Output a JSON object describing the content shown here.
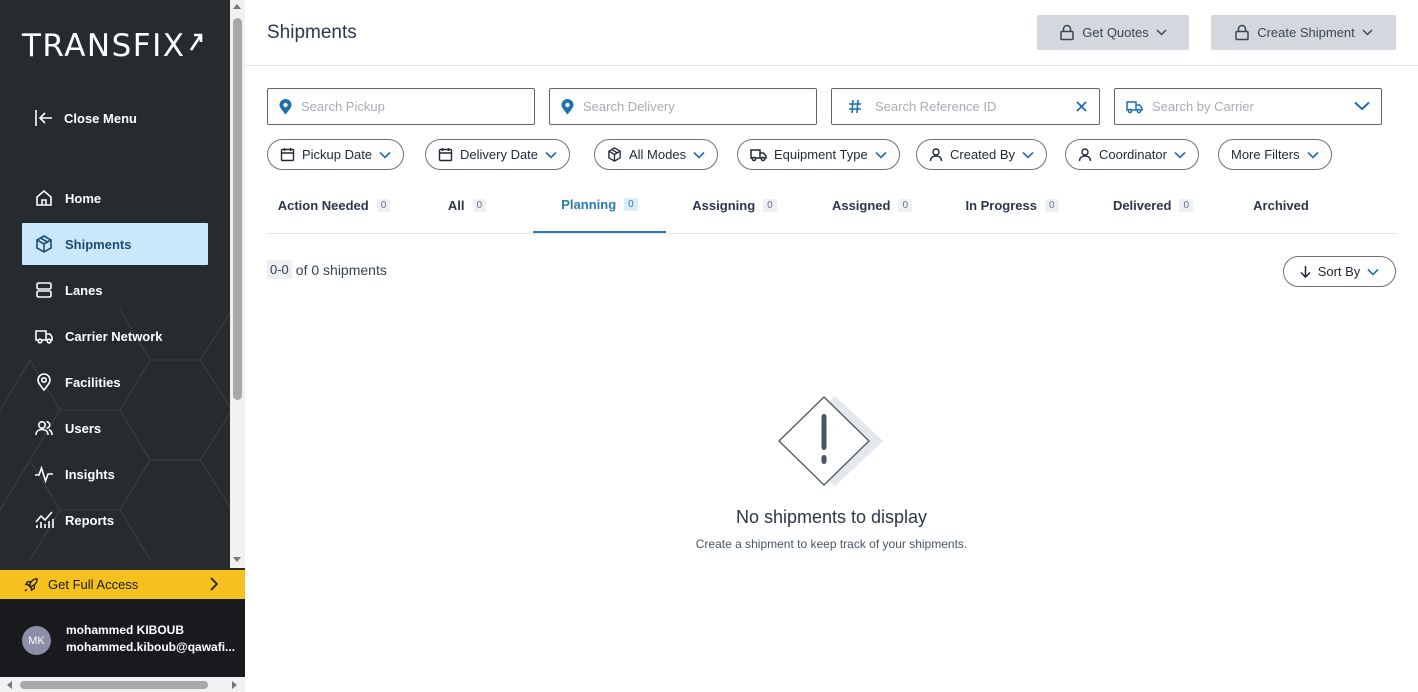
{
  "app": {
    "logo_text": "TRANSFIX"
  },
  "sidebar": {
    "close_menu_label": "Close Menu",
    "items": [
      {
        "label": "Home",
        "icon": "home-icon"
      },
      {
        "label": "Shipments",
        "icon": "box-icon",
        "active": true
      },
      {
        "label": "Lanes",
        "icon": "lanes-icon"
      },
      {
        "label": "Carrier Network",
        "icon": "truck-icon"
      },
      {
        "label": "Facilities",
        "icon": "location-pin-icon"
      },
      {
        "label": "Users",
        "icon": "users-icon"
      },
      {
        "label": "Insights",
        "icon": "pulse-icon"
      },
      {
        "label": "Reports",
        "icon": "chart-icon"
      }
    ],
    "access_label": "Get Full Access",
    "user": {
      "initials": "MK",
      "name": "mohammed KIBOUB",
      "email": "mohammed.kiboub@qawafi..."
    }
  },
  "header": {
    "title": "Shipments",
    "get_quotes_label": "Get Quotes",
    "create_shipment_label": "Create Shipment"
  },
  "search": {
    "pickup_placeholder": "Search Pickup",
    "delivery_placeholder": "Search Delivery",
    "reference_placeholder": "Search Reference ID",
    "carrier_placeholder": "Search by Carrier"
  },
  "filters": {
    "pickup_date": "Pickup Date",
    "delivery_date": "Delivery Date",
    "all_modes": "All Modes",
    "equipment_type": "Equipment Type",
    "created_by": "Created By",
    "coordinator": "Coordinator",
    "more_filters": "More Filters"
  },
  "tabs": [
    {
      "label": "Action Needed",
      "count": "0"
    },
    {
      "label": "All",
      "count": "0"
    },
    {
      "label": "Planning",
      "count": "0",
      "active": true
    },
    {
      "label": "Assigning",
      "count": "0"
    },
    {
      "label": "Assigned",
      "count": "0"
    },
    {
      "label": "In Progress",
      "count": "0"
    },
    {
      "label": "Delivered",
      "count": "0"
    },
    {
      "label": "Archived"
    }
  ],
  "results": {
    "range": "0-0",
    "total_text": "of 0 shipments",
    "sort_label": "Sort By"
  },
  "empty_state": {
    "title": "No shipments to display",
    "subtitle": "Create a shipment to keep track of your shipments."
  },
  "colors": {
    "sidebar_bg": "#262b2f",
    "active_nav_bg": "#c9e8fb",
    "accent": "#2a7ab5",
    "access_bar": "#f4c11f"
  }
}
